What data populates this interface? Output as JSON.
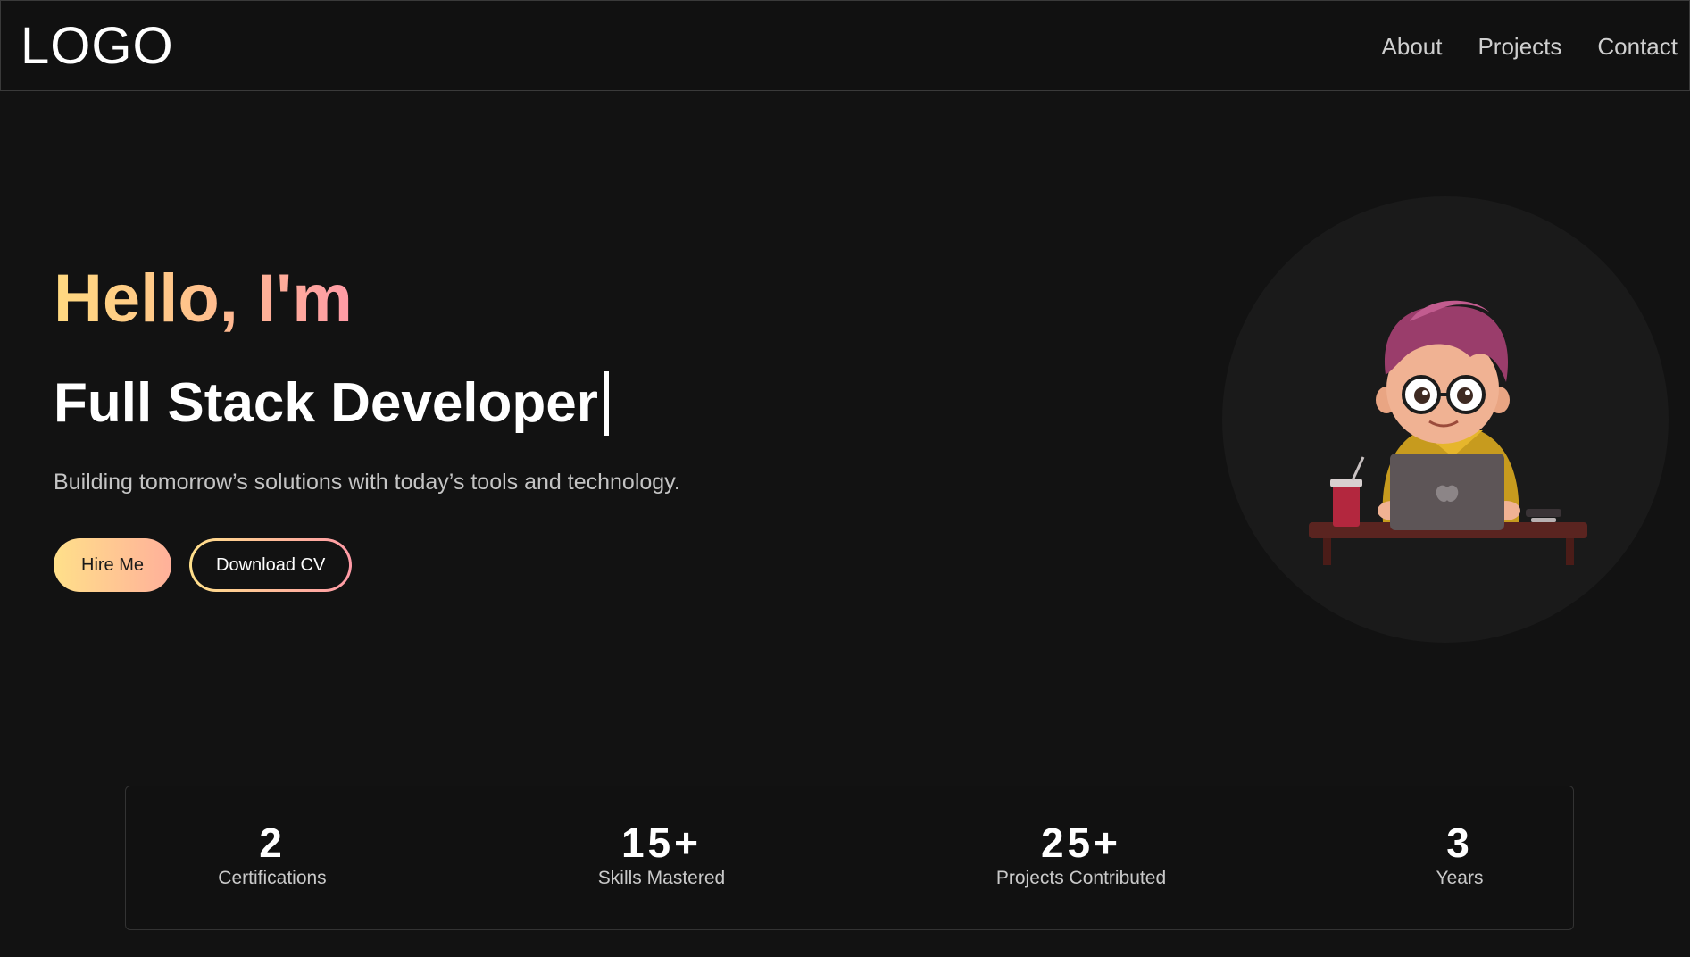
{
  "header": {
    "logo": "LOGO",
    "nav": [
      {
        "label": "About"
      },
      {
        "label": "Projects"
      },
      {
        "label": "Contact"
      }
    ]
  },
  "hero": {
    "greeting": "Hello, I'm",
    "role": "Full Stack Developer",
    "tagline": "Building tomorrow’s solutions with today’s tools and technology.",
    "primary_button": "Hire Me",
    "secondary_button": "Download CV",
    "accent_gradient": [
      "#ffd980",
      "#ff9aa6"
    ]
  },
  "stats": [
    {
      "value": "2",
      "label": "Certifications"
    },
    {
      "value": "15+",
      "label": "Skills Mastered"
    },
    {
      "value": "25+",
      "label": "Projects Contributed"
    },
    {
      "value": "3",
      "label": "Years"
    }
  ]
}
